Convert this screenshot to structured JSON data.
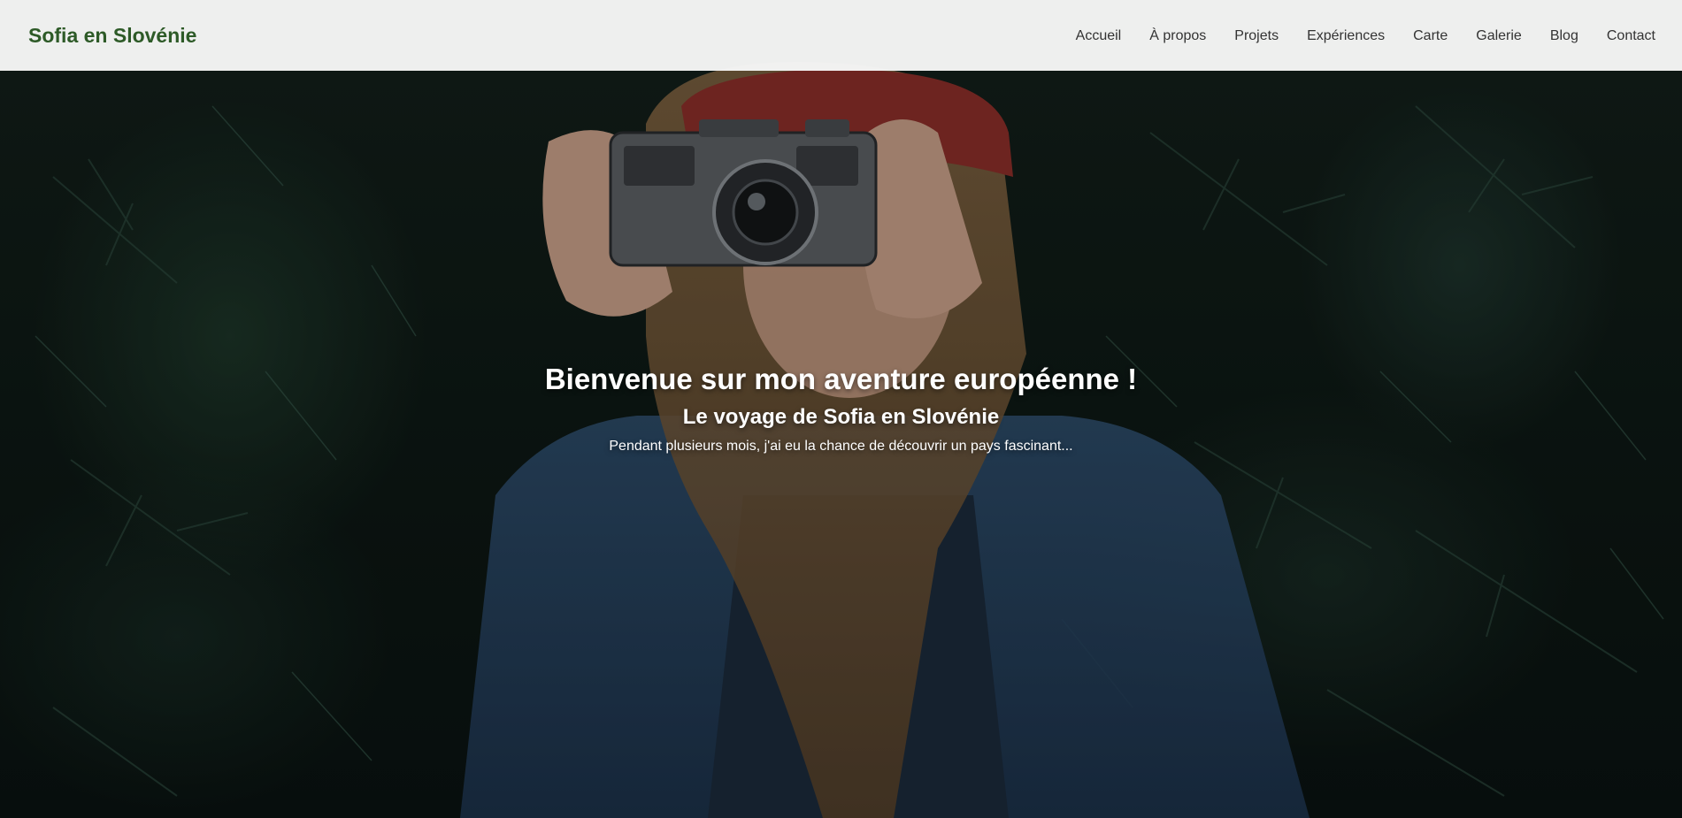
{
  "site": {
    "brand": "Sofia en Slovénie",
    "brand_color": "#2d5a27"
  },
  "nav": {
    "items": [
      {
        "label": "Accueil"
      },
      {
        "label": "À propos"
      },
      {
        "label": "Projets"
      },
      {
        "label": "Expériences"
      },
      {
        "label": "Carte"
      },
      {
        "label": "Galerie"
      },
      {
        "label": "Blog"
      },
      {
        "label": "Contact"
      }
    ]
  },
  "hero": {
    "title": "Bienvenue sur mon aventure européenne !",
    "subtitle": "Le voyage de Sofia en Slovénie",
    "text": "Pendant plusieurs mois, j'ai eu la chance de découvrir un pays fascinant..."
  }
}
